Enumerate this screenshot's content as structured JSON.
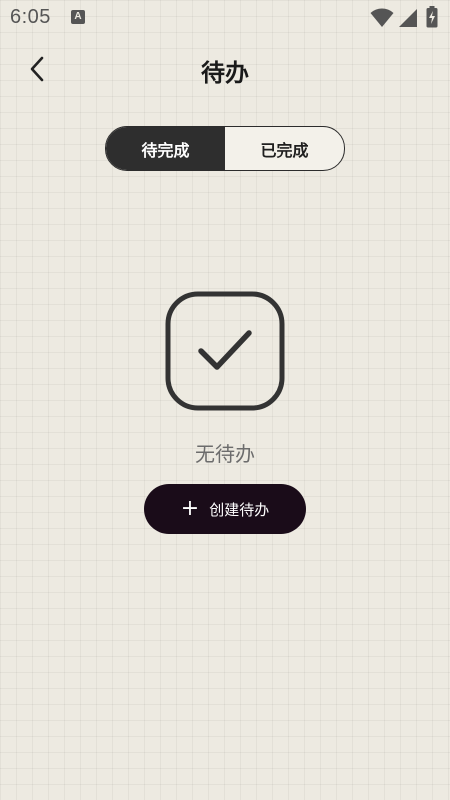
{
  "status_bar": {
    "time": "6:05",
    "notification_icon_letter": "A",
    "icons": [
      "wifi-icon",
      "signal-icon",
      "battery-charging-icon"
    ]
  },
  "header": {
    "title": "待办",
    "back_icon": "chevron-left-icon"
  },
  "tabs": [
    {
      "label": "待完成",
      "active": true
    },
    {
      "label": "已完成",
      "active": false
    }
  ],
  "empty_state": {
    "icon": "checkbox-check-icon",
    "message": "无待办",
    "create_button": {
      "icon": "plus-icon",
      "plus_glyph": "+",
      "label": "创建待办"
    }
  },
  "colors": {
    "background": "#edeae1",
    "accent_dark": "#2e2e2e",
    "button_bg": "#1a0c19",
    "muted_text": "#6c6c6c"
  }
}
